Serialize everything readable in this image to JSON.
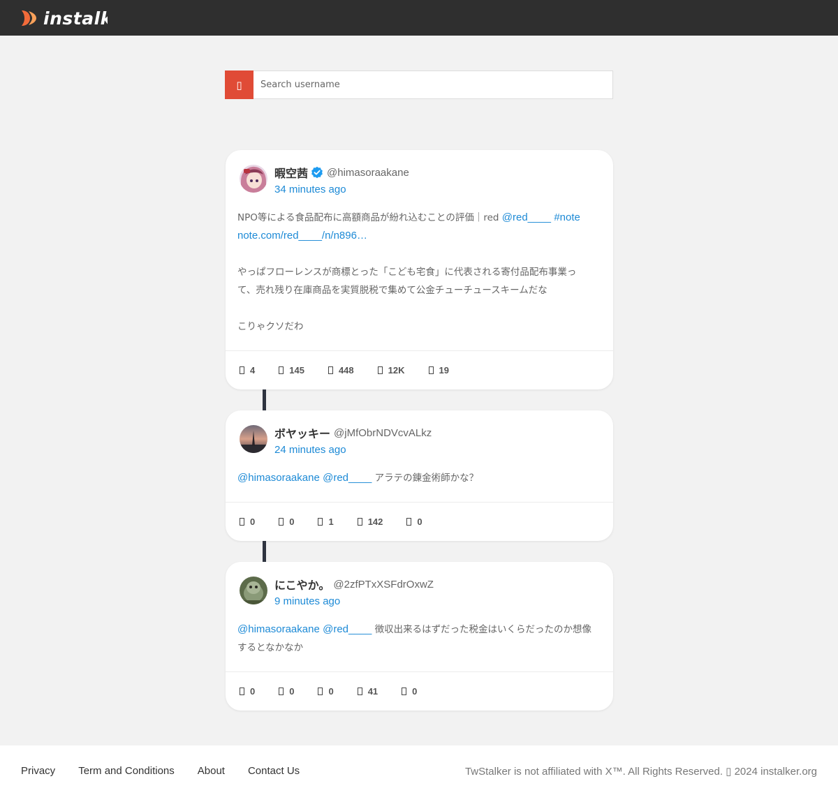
{
  "brand": {
    "name": "instalk"
  },
  "search": {
    "placeholder": "Search username",
    "icon": "search-icon"
  },
  "tweets": [
    {
      "display_name": "暇空茜",
      "verified": true,
      "handle": "@himasoraakane",
      "time": "34 minutes ago",
      "line1_text": "NPO等による食品配布に高額商品が紛れ込むことの評価｜red ",
      "line1_mention": "@red____",
      "line1_hashtag": "#note",
      "line2_link": "note.com/red____/n/n896…",
      "para2_line1": "やっぱフローレンスが商標とった「こども宅食」に代表される寄付品配布事業っ",
      "para2_line2": "て、売れ残り在庫商品を実質脱税で集めて公金チューチュースキームだな",
      "para3": "こりゃクソだわ",
      "stats": [
        "4",
        "145",
        "448",
        "12K",
        "19"
      ]
    },
    {
      "display_name": "ボヤッキー",
      "verified": false,
      "handle": "@jMfObrNDVcvALkz",
      "time": "24 minutes ago",
      "mention1": "@himasoraakane",
      "mention2": "@red____",
      "text": " アラテの錬金術師かな？",
      "stats": [
        "0",
        "0",
        "1",
        "142",
        "0"
      ]
    },
    {
      "display_name": "にこやか。",
      "verified": false,
      "handle": "@2zfPTxXSFdrOxwZ",
      "time": "9 minutes ago",
      "mention1": "@himasoraakane",
      "mention2": "@red____",
      "text": " 徴収出来るはずだった税金はいくらだったのか想像",
      "text_line2": "するとなかなか",
      "stats": [
        "0",
        "0",
        "0",
        "41",
        "0"
      ]
    }
  ],
  "footer": {
    "links": [
      "Privacy",
      "Term and Conditions",
      "About",
      "Contact Us"
    ],
    "copyright": "TwStalker is not affiliated with X™. All Rights Reserved. ▯ 2024 instalker.org"
  },
  "colors": {
    "topbar": "#2f2f2f",
    "accent": "#e04b36",
    "link": "#1d8ad6",
    "verified": "#1d9bf0"
  }
}
